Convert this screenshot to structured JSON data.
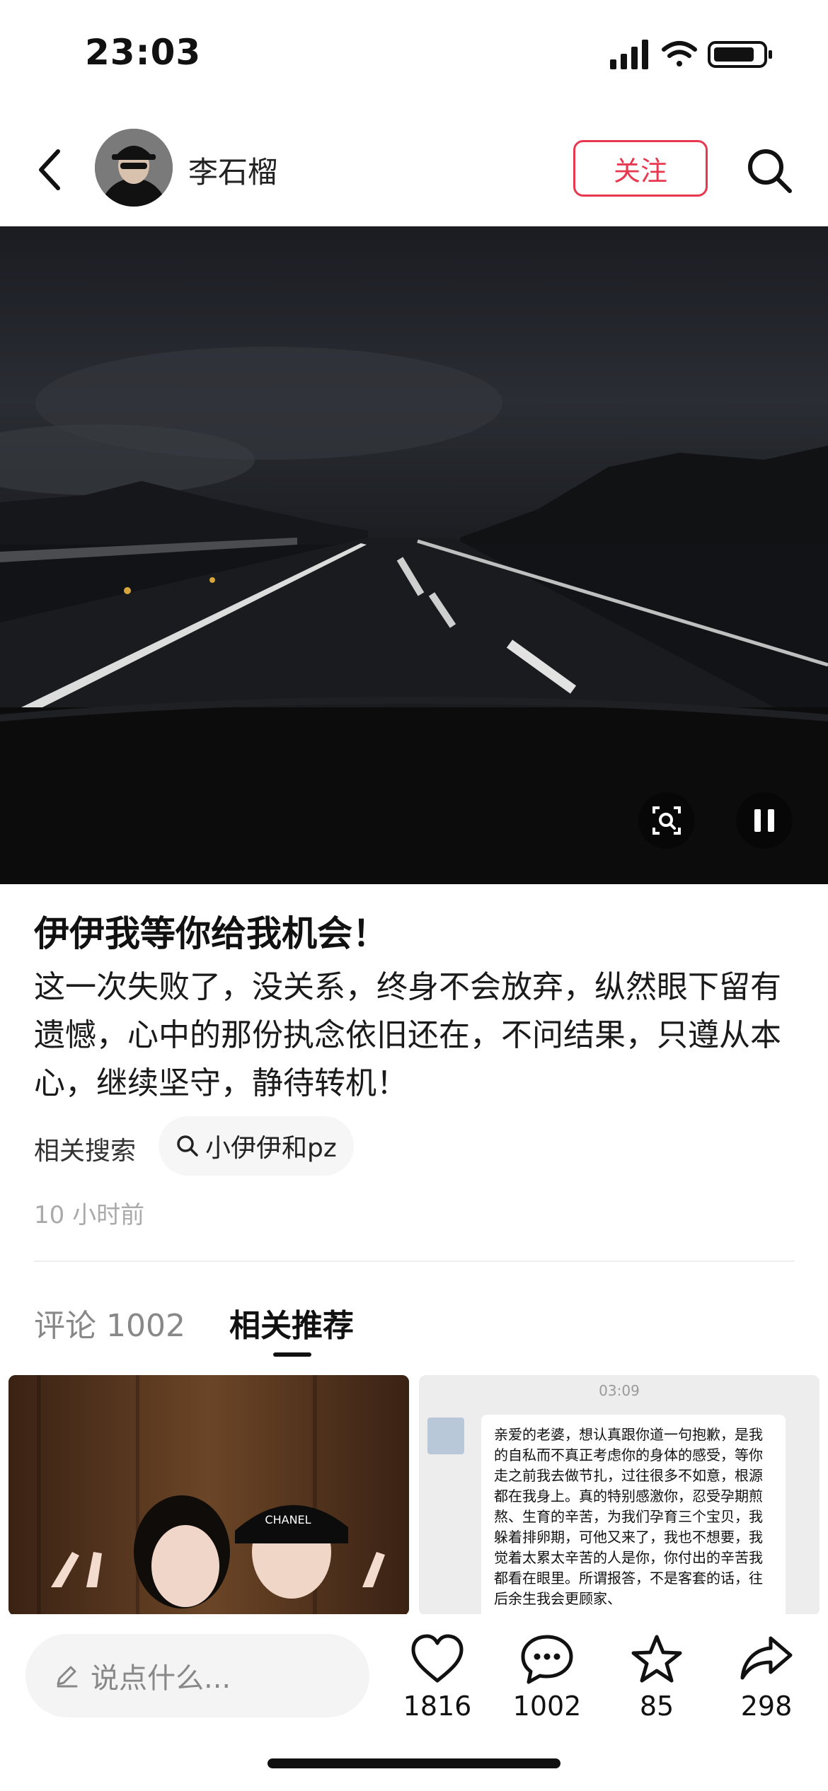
{
  "status_bar": {
    "time": "23:03"
  },
  "header": {
    "author_name": "李石榴",
    "follow_label": "关注"
  },
  "post": {
    "title": "伊伊我等你给我机会！",
    "description": "这一次失败了，没关系，终身不会放弃，纵然眼下留有遗憾，心中的那份执念依旧还在，不问结果，只遵从本心，继续坚守，静待转机！",
    "related_search_label": "相关搜索",
    "related_search_term": "小伊伊和pz",
    "posted_time": "10 小时前"
  },
  "tabs": {
    "comments_label": "评论 1002",
    "recommend_label": "相关推荐"
  },
  "recommendations": {
    "right_card": {
      "chat_time": "03:09",
      "message": "亲爱的老婆，想认真跟你道一句抱歉，是我的自私而不真正考虑你的身体的感受，等你走之前我去做节扎，过往很多不如意，根源都在我身上。真的特别感激你，忍受孕期煎熬、生育的辛苦，为我们孕育三个宝贝，我躲着排卵期，可他又来了，我也不想要，我觉着太累太辛苦的人是你，你付出的辛苦我都看在眼里。所谓报答，不是客套的话，往后余生我会更顾家、"
    },
    "left_card": {
      "cap_text": "CHANEL"
    }
  },
  "bottom_bar": {
    "input_placeholder": "说点什么...",
    "like_count": "1816",
    "comment_count": "1002",
    "star_count": "85",
    "share_count": "298"
  },
  "colors": {
    "accent": "#e8384f",
    "background": "#ffffff",
    "muted_text": "#aaaaaa"
  }
}
